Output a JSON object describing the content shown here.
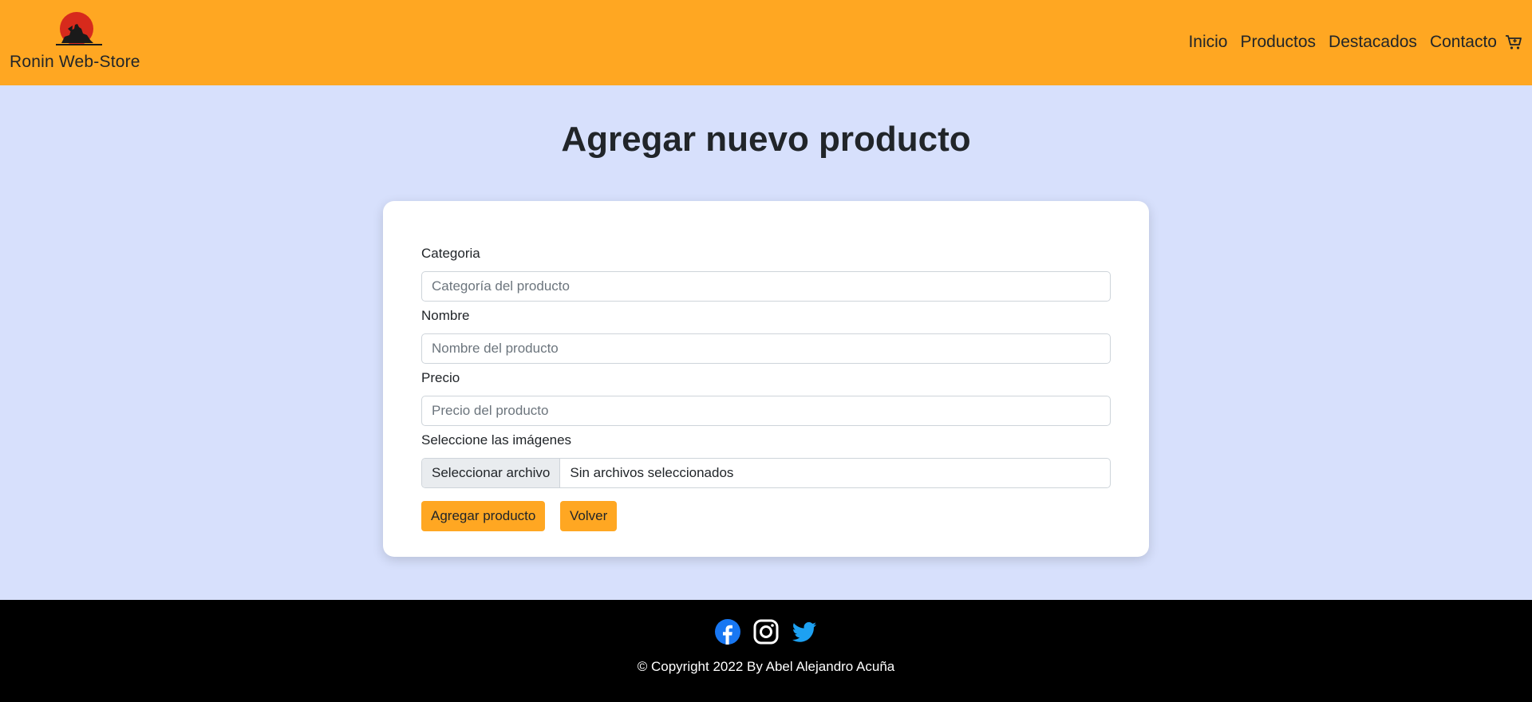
{
  "header": {
    "brand": "Ronin Web-Store",
    "nav": [
      {
        "label": "Inicio"
      },
      {
        "label": "Productos"
      },
      {
        "label": "Destacados"
      },
      {
        "label": "Contacto"
      }
    ],
    "cart_icon": "cart-icon",
    "background_color": "#ffa722"
  },
  "main": {
    "title": "Agregar nuevo producto",
    "form": {
      "category": {
        "label": "Categoria",
        "placeholder": "Categoría del producto",
        "value": ""
      },
      "name": {
        "label": "Nombre",
        "placeholder": "Nombre del producto",
        "value": ""
      },
      "price": {
        "label": "Precio",
        "placeholder": "Precio del producto",
        "value": ""
      },
      "images": {
        "label": "Seleccione las imágenes",
        "button": "Seleccionar archivo",
        "status": "Sin archivos seleccionados"
      },
      "submit_label": "Agregar producto",
      "back_label": "Volver"
    },
    "background_color": "#d7e0fc"
  },
  "footer": {
    "social_icons": [
      "facebook-icon",
      "instagram-icon",
      "twitter-icon"
    ],
    "copyright": "© Copyright 2022 By Abel Alejandro Acuña",
    "background_color": "#000000"
  }
}
